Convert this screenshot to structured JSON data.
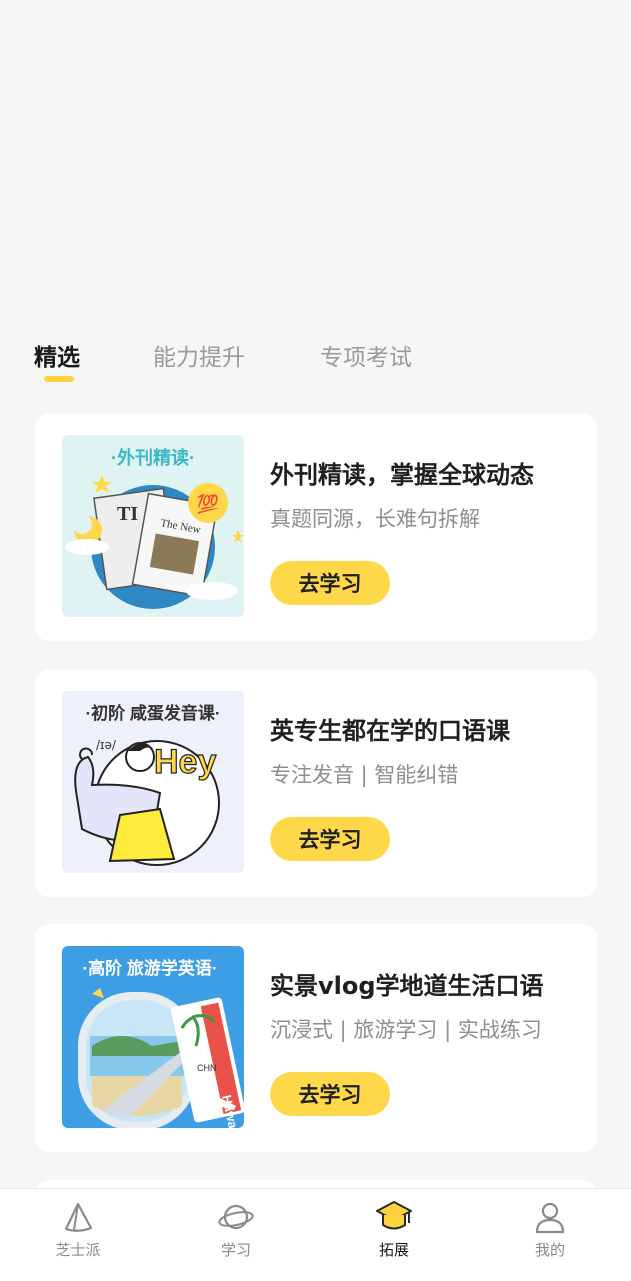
{
  "tabs": [
    "精选",
    "能力提升",
    "专项考试"
  ],
  "cards": [
    {
      "thumb_label": "·外刊精读·",
      "title": "外刊精读，掌握全球动态",
      "subtitle": "真题同源，长难句拆解",
      "button": "去学习",
      "badge": "💯",
      "paper_text_1": "TI",
      "paper_text_2": "The New"
    },
    {
      "thumb_label": "·初阶 咸蛋发音课·",
      "title": "英专生都在学的口语课",
      "subtitle": "专注发音 | 智能纠错",
      "button": "去学习",
      "phonetic": "/ɪə/",
      "hey": "Hey"
    },
    {
      "thumb_label": "·高阶 旅游学英语·",
      "title": "实景vlog学地道生活口语",
      "subtitle": "沉浸式 | 旅游学习 | 实战练习",
      "button": "去学习",
      "ticket_text": "Hawaii",
      "ticket_code": "CHN"
    }
  ],
  "bottom_nav": [
    {
      "label": "芝士派",
      "icon": "cheese-icon"
    },
    {
      "label": "学习",
      "icon": "planet-icon"
    },
    {
      "label": "拓展",
      "icon": "graduation-cap-icon",
      "active": true
    },
    {
      "label": "我的",
      "icon": "person-icon"
    }
  ],
  "colors": {
    "accent": "#ffd84a",
    "background": "#f6f6f6"
  }
}
